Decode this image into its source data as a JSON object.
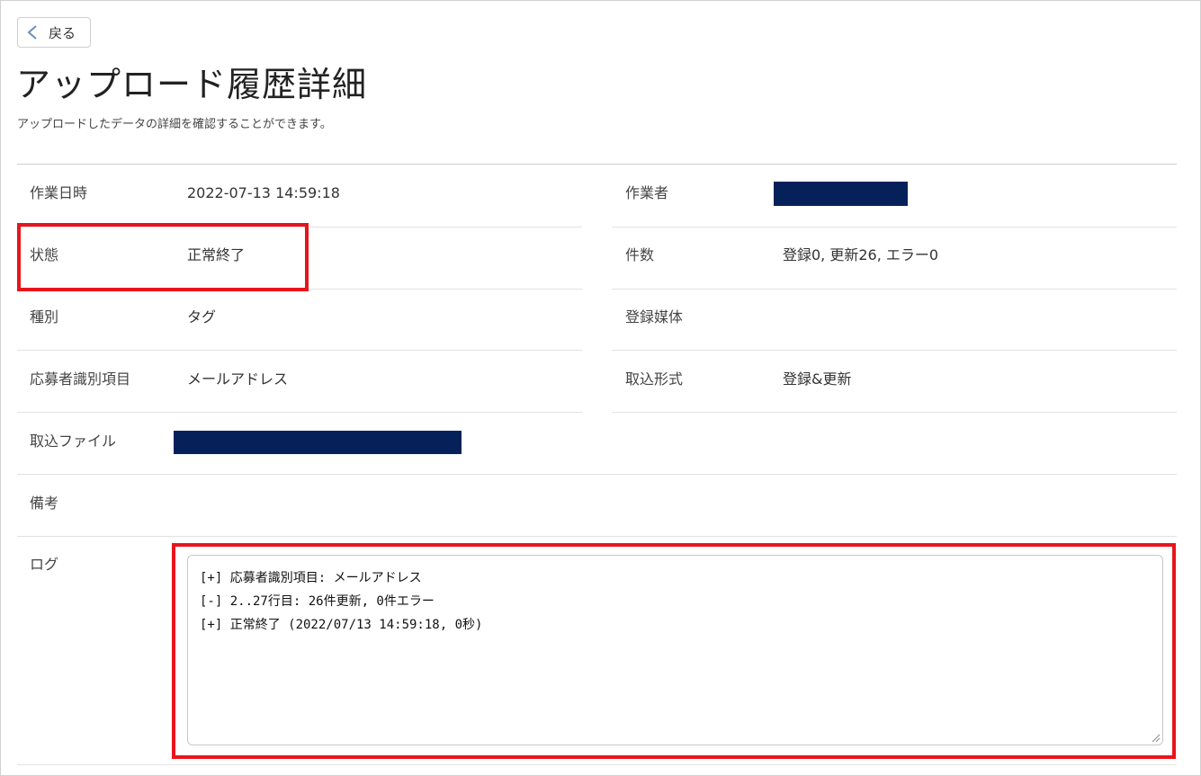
{
  "toolbar": {
    "back_label": "戻る"
  },
  "header": {
    "title": "アップロード履歴詳細",
    "subtitle": "アップロードしたデータの詳細を確認することができます。"
  },
  "details": {
    "work_datetime": {
      "label": "作業日時",
      "value": "2022-07-13 14:59:18"
    },
    "operator": {
      "label": "作業者",
      "value": ""
    },
    "status": {
      "label": "状態",
      "value": "正常終了"
    },
    "count": {
      "label": "件数",
      "value": "登録0, 更新26, エラー0"
    },
    "kind": {
      "label": "種別",
      "value": "タグ"
    },
    "media": {
      "label": "登録媒体",
      "value": ""
    },
    "applicant_id_item": {
      "label": "応募者識別項目",
      "value": "メールアドレス"
    },
    "import_format": {
      "label": "取込形式",
      "value": "登録&更新"
    },
    "import_file": {
      "label": "取込ファイル",
      "value": ""
    },
    "remarks": {
      "label": "備考",
      "value": ""
    },
    "log": {
      "label": "ログ",
      "lines": [
        "[+] 応募者識別項目: メールアドレス",
        "[-] 2..27行目: 26件更新, 0件エラー",
        "[+] 正常終了 (2022/07/13 14:59:18, 0秒)"
      ]
    }
  },
  "colors": {
    "redaction": "#06215a",
    "highlight": "#e8141c"
  }
}
